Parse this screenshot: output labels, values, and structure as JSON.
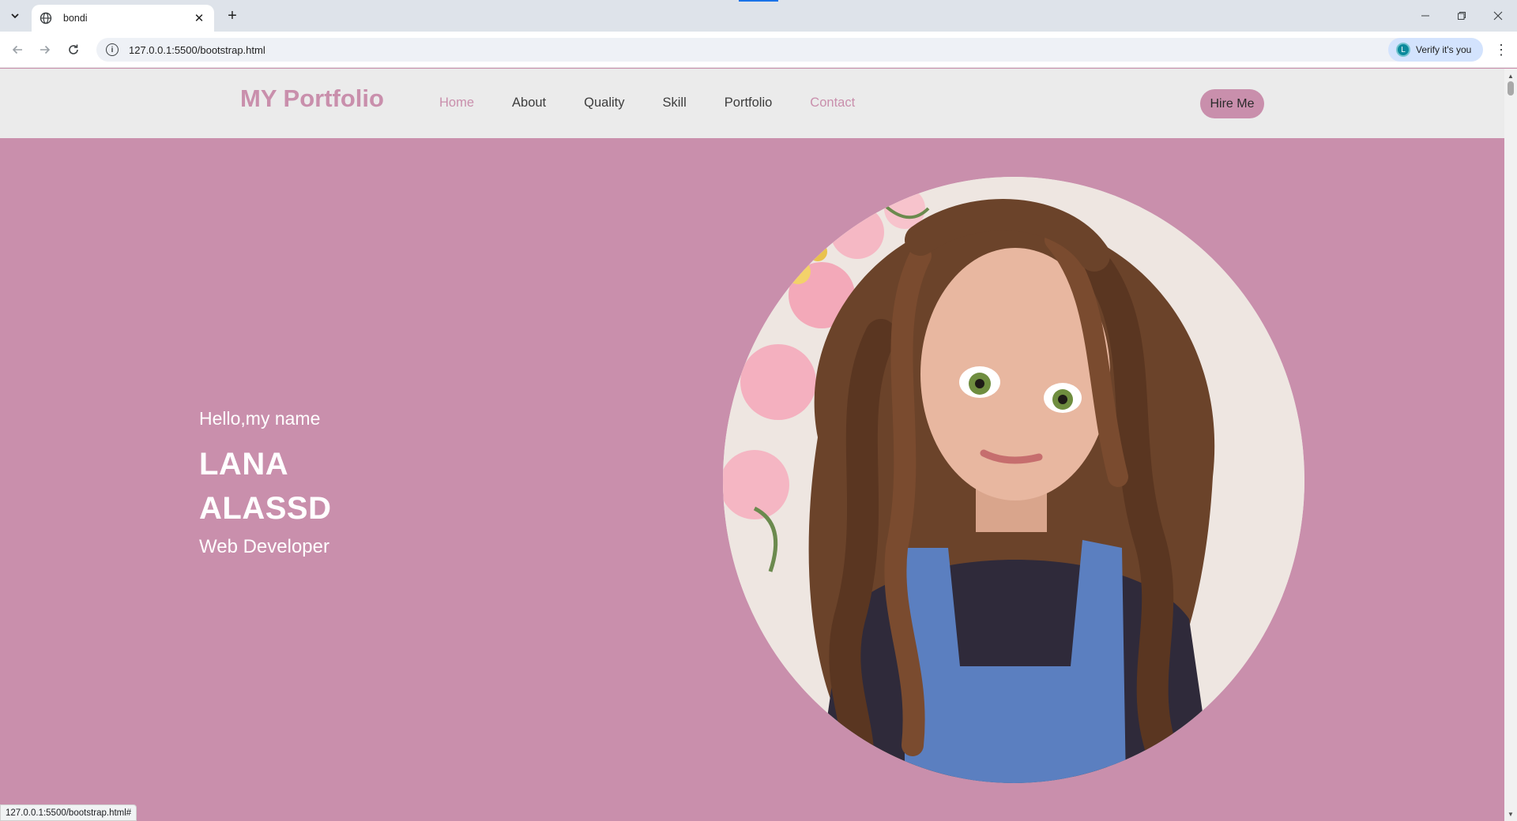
{
  "browser": {
    "tab_title": "bondi",
    "tab_close": "✕",
    "new_tab": "+",
    "url": "127.0.0.1:5500/bootstrap.html",
    "profile_label": "Verify it's you",
    "profile_initial": "L",
    "status_url": "127.0.0.1:5500/bootstrap.html#"
  },
  "navbar": {
    "brand": "MY Portfolio",
    "links": [
      "Home",
      "About",
      "Quality",
      "Skill",
      "Portfolio",
      "Contact"
    ],
    "cta": "Hire Me"
  },
  "hero": {
    "greeting": "Hello,my name",
    "first_name": "LANA",
    "last_name": "ALASSD",
    "role": "Web Developer",
    "image": "curly-haired-girl-illustration"
  },
  "colors": {
    "accent": "#c98fac",
    "navbar_bg": "#ebebeb",
    "text_dark": "#3d3d3d"
  }
}
